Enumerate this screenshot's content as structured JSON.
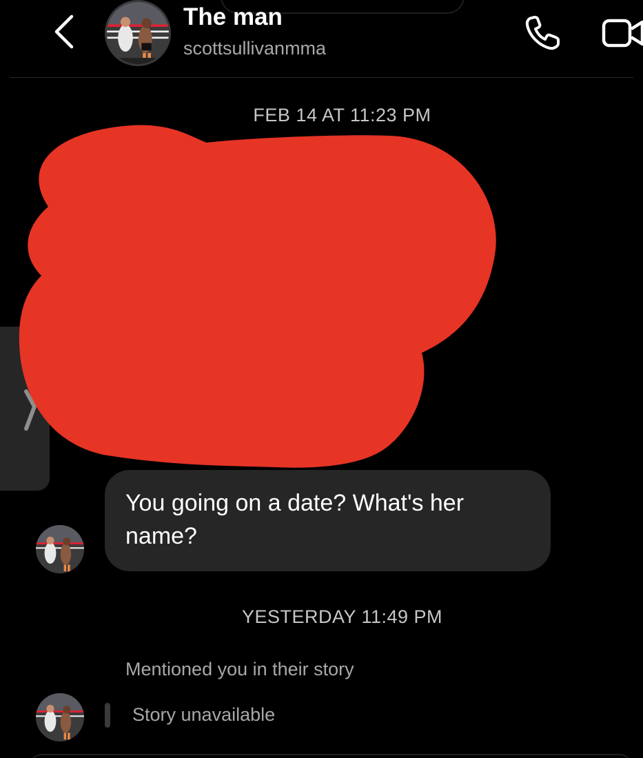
{
  "header": {
    "contact_name": "The man",
    "username": "scottsullivanmma",
    "icons": {
      "back": "chevron-left-icon",
      "call": "phone-icon",
      "video": "video-camera-icon"
    }
  },
  "thread": {
    "timestamp_1": "FEB 14 AT 11:23 PM",
    "redacted_color": "#e63425",
    "message_1": "You going on a date? What's her name?",
    "timestamp_2": "YESTERDAY 11:49 PM",
    "story_mention": "Mentioned you in their story",
    "story_status": "Story unavailable"
  },
  "colors": {
    "background": "#000000",
    "bubble": "#262626",
    "secondary_text": "#a8a8a8"
  }
}
